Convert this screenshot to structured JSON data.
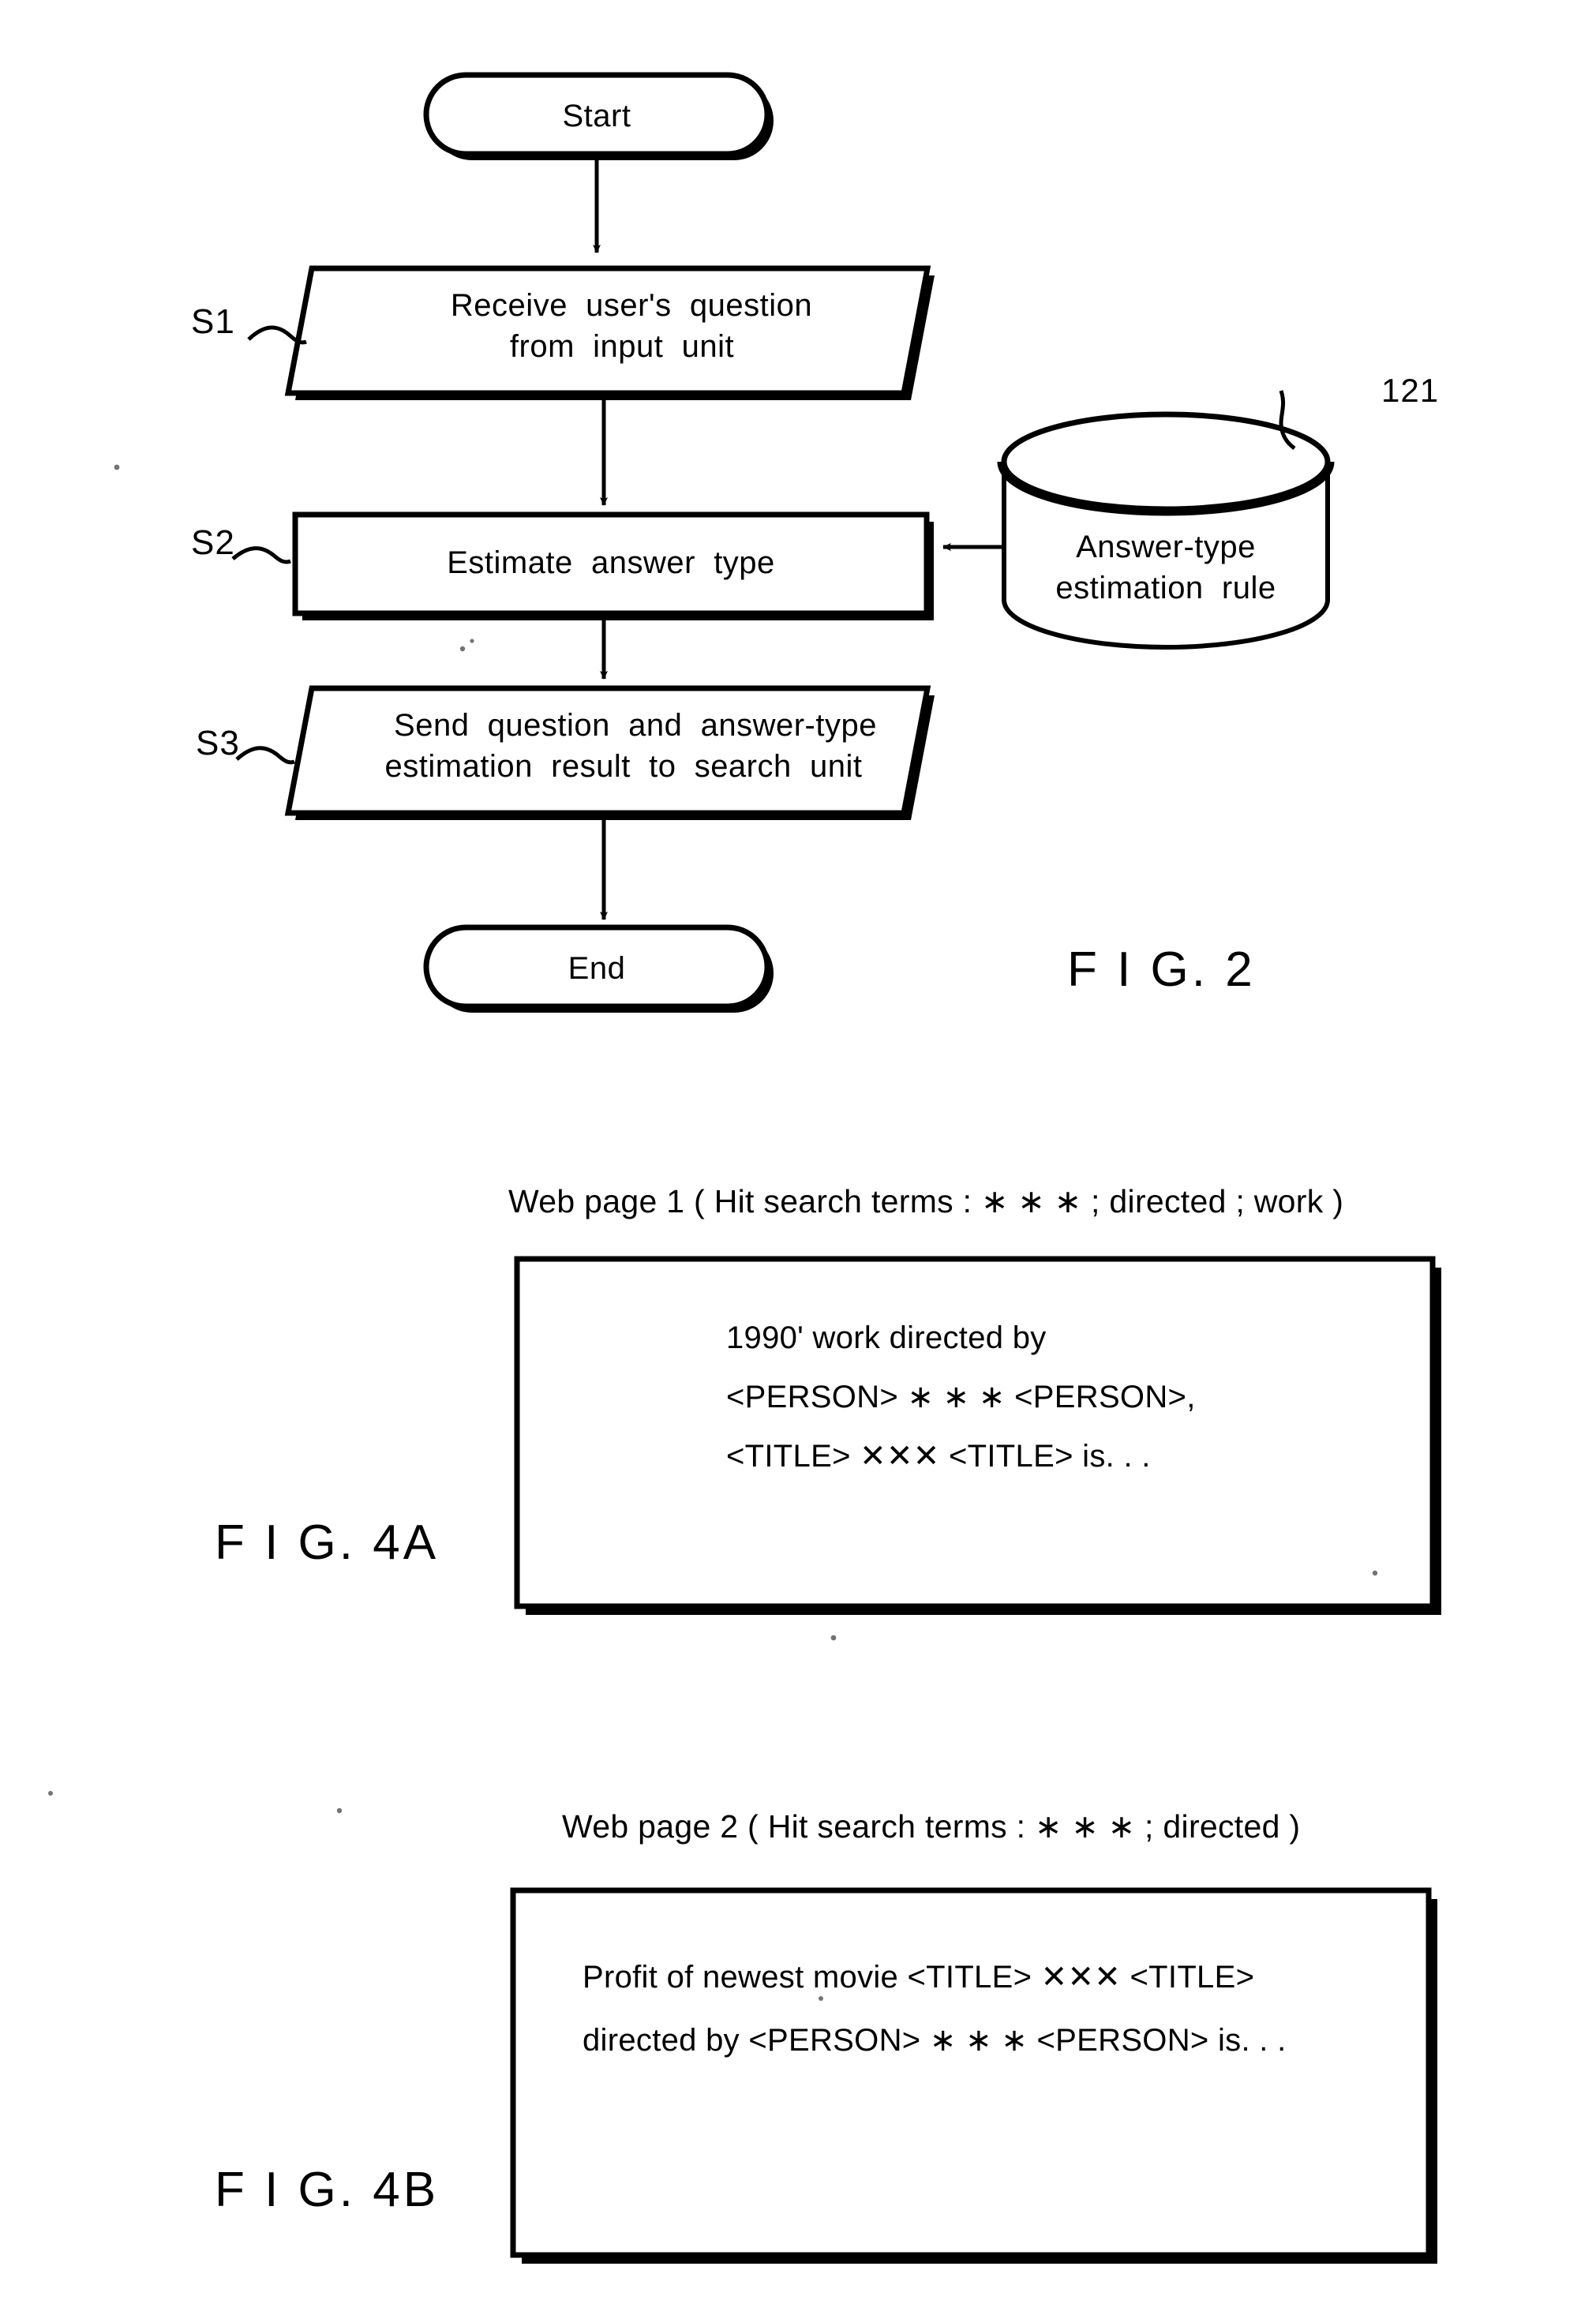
{
  "figure2": {
    "title": "F I G. 2",
    "nodes": {
      "start": "Start",
      "end": "End",
      "s1_text_line1": "Receive  user's  question",
      "s1_text_line2": "from  input  unit",
      "s2_text": "Estimate  answer  type",
      "s3_text_line1": "Send  question  and  answer-type",
      "s3_text_line2": "estimation  result  to  search  unit"
    },
    "step_labels": {
      "s1": "S1",
      "s2": "S2",
      "s3": "S3"
    },
    "database": {
      "ref_number": "121",
      "label_line1": "Answer-type",
      "label_line2": "estimation  rule"
    }
  },
  "figure4a": {
    "title": "F I G. 4A",
    "caption": "Web page 1 ( Hit search terms : ∗ ∗ ∗ ; directed ; work )",
    "body_lines": [
      "1990' work directed by",
      "<PERSON> ∗ ∗ ∗ <PERSON>,",
      "<TITLE> ✕✕✕ <TITLE> is. . ."
    ]
  },
  "figure4b": {
    "title": "F I G. 4B",
    "caption": "Web page 2 ( Hit search terms : ∗ ∗ ∗ ; directed )",
    "body_lines": [
      "Profit of newest movie <TITLE> ✕✕✕ <TITLE>",
      "directed by <PERSON> ∗ ∗ ∗ <PERSON> is. . ."
    ]
  },
  "colors": {
    "ink": "#000000",
    "paper": "#ffffff"
  }
}
